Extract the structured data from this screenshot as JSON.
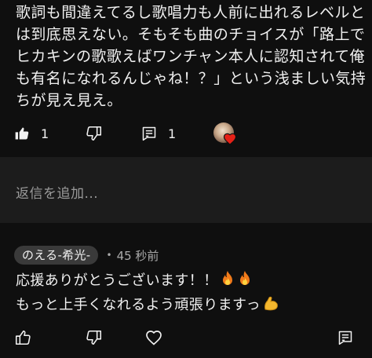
{
  "comment": {
    "lines": [
      "歌詞も間違えてるし歌唱力も人前に出れるレベルと",
      "は到底思えない。そもそも曲のチョイスが「路上で",
      "ヒカキンの歌歌えばワンチャン本人に認知されて俺",
      "も有名になれるんじゃね！？」という浅ましい気持",
      "ちが見え見え。"
    ],
    "like_count": "1",
    "reply_count": "1",
    "icons": {
      "like": "thumbs-up-filled-icon",
      "dislike": "thumbs-down-icon",
      "replies": "comment-icon",
      "creator_heart": "heart-icon"
    }
  },
  "reply_input": {
    "placeholder": "返信を追加..."
  },
  "reply": {
    "author": "のえる-希光-",
    "separator": "•",
    "time": "45 秒前",
    "line1": "応援ありがとうございます！！",
    "line2": "もっと上手くなれるよう頑張りますっ",
    "icons": {
      "emoji1": "fire-emoji-icon",
      "emoji2": "flexed-biceps-emoji-icon",
      "like": "thumbs-up-icon",
      "dislike": "thumbs-down-icon",
      "heart": "heart-outline-icon"
    }
  },
  "colors": {
    "background": "#0f0f0f",
    "input_background": "#1c1c1c",
    "text": "#f1f1f1",
    "secondary_text": "#aaaaaa",
    "heart_red": "#e62117",
    "chip": "#3a3a3a"
  }
}
